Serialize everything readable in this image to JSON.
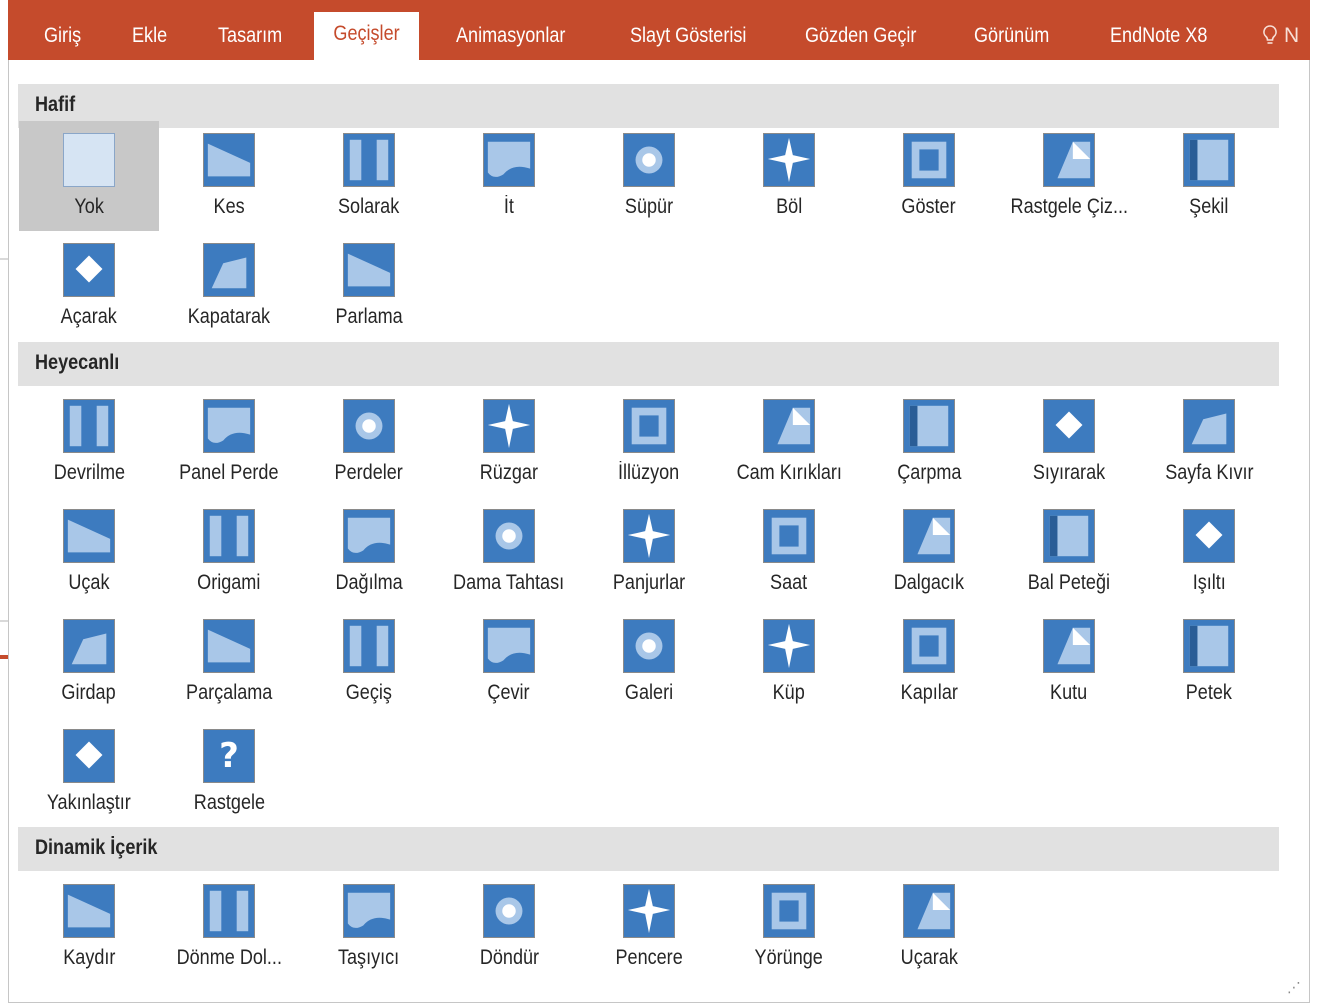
{
  "ribbon": {
    "tabs": [
      {
        "label": "Giriş",
        "active": false
      },
      {
        "label": "Ekle",
        "active": false
      },
      {
        "label": "Tasarım",
        "active": false
      },
      {
        "label": "Geçişler",
        "active": true
      },
      {
        "label": "Animasyonlar",
        "active": false
      },
      {
        "label": "Slayt Gösterisi",
        "active": false
      },
      {
        "label": "Gözden Geçir",
        "active": false
      },
      {
        "label": "Görünüm",
        "active": false
      },
      {
        "label": "EndNote X8",
        "active": false
      }
    ],
    "tell_me_fragment": "N",
    "accent_color": "#c54b2c"
  },
  "gallery": {
    "sections": [
      {
        "title": "Hafif",
        "items": [
          {
            "label": "Yok",
            "icon": "none-transition-icon",
            "selected": true
          },
          {
            "label": "Kes",
            "icon": "cut-transition-icon"
          },
          {
            "label": "Solarak",
            "icon": "fade-transition-icon"
          },
          {
            "label": "İt",
            "icon": "push-transition-icon"
          },
          {
            "label": "Süpür",
            "icon": "wipe-transition-icon"
          },
          {
            "label": "Böl",
            "icon": "split-transition-icon"
          },
          {
            "label": "Göster",
            "icon": "reveal-transition-icon"
          },
          {
            "label": "Rastgele Çiz...",
            "icon": "random-bars-transition-icon"
          },
          {
            "label": "Şekil",
            "icon": "shape-transition-icon"
          },
          {
            "label": "Açarak",
            "icon": "uncover-transition-icon"
          },
          {
            "label": "Kapatarak",
            "icon": "cover-transition-icon"
          },
          {
            "label": "Parlama",
            "icon": "flash-transition-icon"
          }
        ]
      },
      {
        "title": "Heyecanlı",
        "items": [
          {
            "label": "Devrilme",
            "icon": "fall-over-transition-icon"
          },
          {
            "label": "Panel Perde",
            "icon": "drape-transition-icon"
          },
          {
            "label": "Perdeler",
            "icon": "curtains-transition-icon"
          },
          {
            "label": "Rüzgar",
            "icon": "wind-transition-icon"
          },
          {
            "label": "İllüzyon",
            "icon": "prestige-transition-icon"
          },
          {
            "label": "Cam Kırıkları",
            "icon": "fracture-transition-icon"
          },
          {
            "label": "Çarpma",
            "icon": "crush-transition-icon"
          },
          {
            "label": "Sıyırarak",
            "icon": "peel-off-transition-icon"
          },
          {
            "label": "Sayfa Kıvır",
            "icon": "page-curl-transition-icon"
          },
          {
            "label": "Uçak",
            "icon": "airplane-transition-icon"
          },
          {
            "label": "Origami",
            "icon": "origami-transition-icon"
          },
          {
            "label": "Dağılma",
            "icon": "dissolve-transition-icon"
          },
          {
            "label": "Dama Tahtası",
            "icon": "checkerboard-transition-icon"
          },
          {
            "label": "Panjurlar",
            "icon": "blinds-transition-icon"
          },
          {
            "label": "Saat",
            "icon": "clock-transition-icon"
          },
          {
            "label": "Dalgacık",
            "icon": "ripple-transition-icon"
          },
          {
            "label": "Bal Peteği",
            "icon": "honeycomb-transition-icon"
          },
          {
            "label": "Işıltı",
            "icon": "glitter-transition-icon"
          },
          {
            "label": "Girdap",
            "icon": "vortex-transition-icon"
          },
          {
            "label": "Parçalama",
            "icon": "shred-transition-icon"
          },
          {
            "label": "Geçiş",
            "icon": "switch-transition-icon"
          },
          {
            "label": "Çevir",
            "icon": "flip-transition-icon"
          },
          {
            "label": "Galeri",
            "icon": "gallery-transition-icon"
          },
          {
            "label": "Küp",
            "icon": "cube-transition-icon"
          },
          {
            "label": "Kapılar",
            "icon": "doors-transition-icon"
          },
          {
            "label": "Kutu",
            "icon": "box-transition-icon"
          },
          {
            "label": "Petek",
            "icon": "comb-transition-icon"
          },
          {
            "label": "Yakınlaştır",
            "icon": "zoom-transition-icon"
          },
          {
            "label": "Rastgele",
            "icon": "random-transition-icon"
          }
        ]
      },
      {
        "title": "Dinamik İçerik",
        "items": [
          {
            "label": "Kaydır",
            "icon": "pan-transition-icon"
          },
          {
            "label": "Dönme Dol...",
            "icon": "ferris-wheel-transition-icon"
          },
          {
            "label": "Taşıyıcı",
            "icon": "conveyor-transition-icon"
          },
          {
            "label": "Döndür",
            "icon": "rotate-transition-icon"
          },
          {
            "label": "Pencere",
            "icon": "window-transition-icon"
          },
          {
            "label": "Yörünge",
            "icon": "orbit-transition-icon"
          },
          {
            "label": "Uçarak",
            "icon": "fly-through-transition-icon"
          }
        ]
      }
    ],
    "random_glyph": "?"
  }
}
